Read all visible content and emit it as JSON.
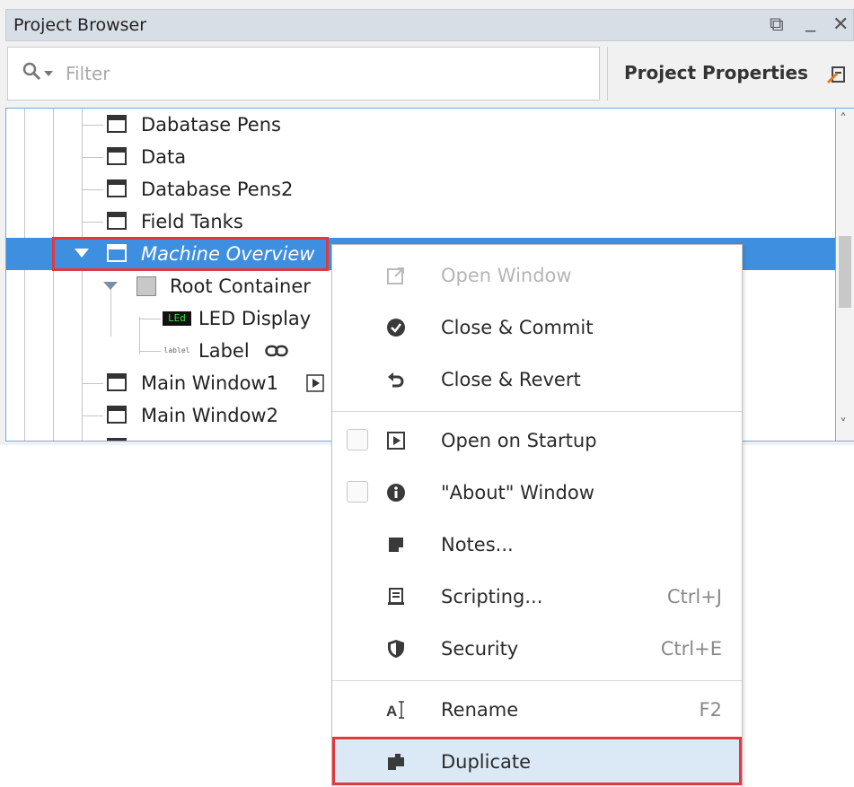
{
  "panel": {
    "title": "Project Browser",
    "restore_glyph": "⧉",
    "minimize_glyph": "_",
    "close_glyph": "✕"
  },
  "toolbar": {
    "filter_placeholder": "Filter",
    "project_properties_label": "Project Properties"
  },
  "tree": {
    "rows": [
      {
        "label": "Dabatase Pens"
      },
      {
        "label": "Data"
      },
      {
        "label": "Database Pens2"
      },
      {
        "label": "Field Tanks"
      },
      {
        "label": "Machine Overview"
      },
      {
        "label": "Root Container"
      },
      {
        "label": "LED Display",
        "icon_text": "LEd"
      },
      {
        "label": "Label",
        "icon_text": "lablel"
      },
      {
        "label": "Main Window1"
      },
      {
        "label": "Main Window2"
      }
    ],
    "selected_label": "Machine Overview"
  },
  "menu": {
    "items": [
      {
        "label": "Open Window",
        "icon": "open-window-icon",
        "disabled": true
      },
      {
        "label": "Close & Commit",
        "icon": "check-circle-icon"
      },
      {
        "label": "Close & Revert",
        "icon": "revert-icon"
      },
      {
        "label": "Open on Startup",
        "icon": "play-box-icon",
        "checkbox": true
      },
      {
        "label": "\"About\" Window",
        "icon": "info-icon",
        "checkbox": true
      },
      {
        "label": "Notes...",
        "icon": "note-icon"
      },
      {
        "label": "Scripting...",
        "icon": "script-icon",
        "shortcut": "Ctrl+J"
      },
      {
        "label": "Security",
        "icon": "shield-icon",
        "shortcut": "Ctrl+E"
      },
      {
        "label": "Rename",
        "icon": "rename-icon",
        "shortcut": "F2"
      },
      {
        "label": "Duplicate",
        "icon": "duplicate-icon",
        "highlighted": true
      }
    ]
  },
  "colors": {
    "selection": "#3e8fe0",
    "highlight_box": "#e0393e",
    "menu_hover": "#dbe8f5"
  }
}
